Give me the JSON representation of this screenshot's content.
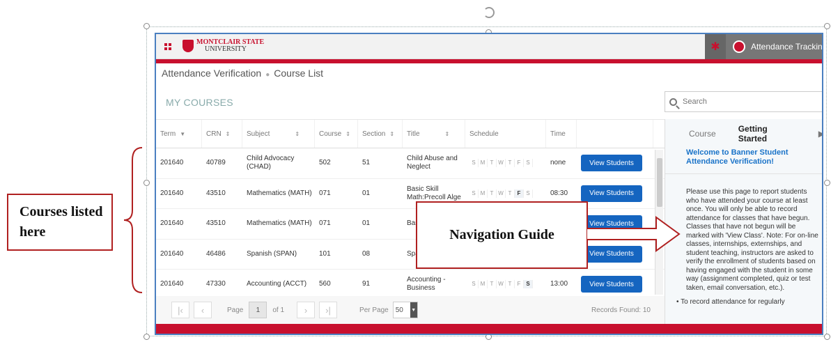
{
  "header": {
    "logo_line1": "MONTCLAIR STATE",
    "logo_line2": "UNIVERSITY",
    "user_label": "Attendance Tracking"
  },
  "breadcrumb": {
    "part1": "Attendance Verification",
    "part2": "Course List"
  },
  "section_title": "MY COURSES",
  "search": {
    "placeholder": "Search"
  },
  "table": {
    "headers": [
      "Term",
      "CRN",
      "Subject",
      "Course",
      "Section",
      "Title",
      "Schedule",
      "Time"
    ],
    "day_letters": [
      "S",
      "M",
      "T",
      "W",
      "T",
      "F",
      "S"
    ],
    "action_label": "View Students",
    "rows": [
      {
        "term": "201640",
        "crn": "40789",
        "subject": "Child Advocacy (CHAD)",
        "course": "502",
        "section": "51",
        "title": "Child Abuse and Neglect",
        "time": "none"
      },
      {
        "term": "201640",
        "crn": "43510",
        "subject": "Mathematics (MATH)",
        "course": "071",
        "section": "01",
        "title": "Basic Skill Math:Precoll Alge",
        "time": "08:30"
      },
      {
        "term": "201640",
        "crn": "43510",
        "subject": "Mathematics (MATH)",
        "course": "071",
        "section": "01",
        "title": "Bas Mat Alge",
        "time": ""
      },
      {
        "term": "201640",
        "crn": "46486",
        "subject": "Spanish (SPAN)",
        "course": "101",
        "section": "08",
        "title": "Spa",
        "time": ""
      },
      {
        "term": "201640",
        "crn": "47330",
        "subject": "Accounting (ACCT)",
        "course": "560",
        "section": "91",
        "title": "Accounting - Business",
        "time": "13:00"
      }
    ]
  },
  "pager": {
    "page_label": "Page",
    "page_value": "1",
    "of_label": "of 1",
    "per_page_label": "Per Page",
    "per_page_value": "50",
    "records": "Records Found: 10"
  },
  "side_panel": {
    "tab_course": "Course",
    "tab_getting_started": "Getting Started",
    "welcome": "Welcome to Banner Student Attendance Verification!",
    "body": "Please use this page to report students who have attended your course at least once. You will only be able to record attendance for classes that have begun. Classes that have not begun will be marked with 'View Class'. Note: For on-line classes, internships, externships, and student teaching, instructors are asked to verify the enrollment of students based on having engaged with the student in some way (assignment completed, quiz or test taken, email conversation, etc.).",
    "bullet": "To record attendance for regularly"
  },
  "annotations": {
    "courses_label": "Courses listed here",
    "nav_label": "Navigation Guide"
  },
  "colors": {
    "brand_red": "#c8102e",
    "button_blue": "#1565c0",
    "callout_red": "#b02020"
  }
}
